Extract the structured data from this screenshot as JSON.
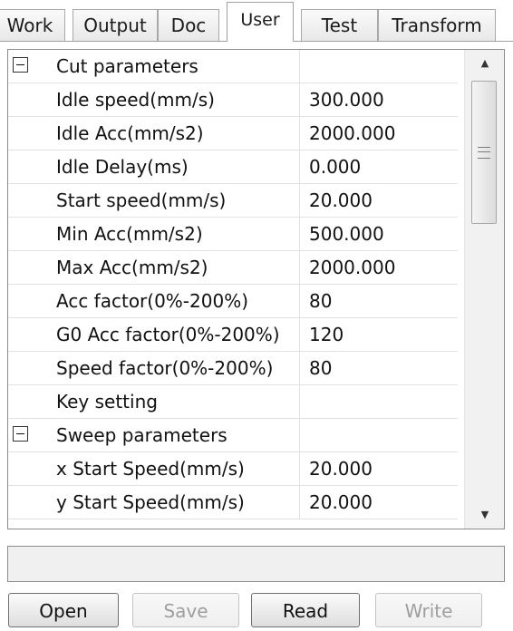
{
  "tabs": [
    {
      "label": "Work"
    },
    {
      "label": "Output"
    },
    {
      "label": "Doc"
    },
    {
      "label": "User",
      "active": true
    },
    {
      "label": "Test"
    },
    {
      "label": "Transform"
    }
  ],
  "grid": {
    "rows": [
      {
        "type": "category",
        "name": "Cut parameters",
        "value": ""
      },
      {
        "type": "property",
        "name": "Idle speed(mm/s)",
        "value": "300.000"
      },
      {
        "type": "property",
        "name": "Idle Acc(mm/s2)",
        "value": "2000.000"
      },
      {
        "type": "property",
        "name": "Idle Delay(ms)",
        "value": "0.000"
      },
      {
        "type": "property",
        "name": "Start speed(mm/s)",
        "value": "20.000"
      },
      {
        "type": "property",
        "name": "Min Acc(mm/s2)",
        "value": "500.000"
      },
      {
        "type": "property",
        "name": "Max Acc(mm/s2)",
        "value": "2000.000"
      },
      {
        "type": "property",
        "name": "Acc factor(0%-200%)",
        "value": "80"
      },
      {
        "type": "property",
        "name": "G0 Acc factor(0%-200%)",
        "value": "120"
      },
      {
        "type": "property",
        "name": "Speed factor(0%-200%)",
        "value": "80"
      },
      {
        "type": "property",
        "name": "Key setting",
        "value": ""
      },
      {
        "type": "category",
        "name": "Sweep parameters",
        "value": ""
      },
      {
        "type": "property",
        "name": "x Start Speed(mm/s)",
        "value": "20.000"
      },
      {
        "type": "property",
        "name": "y Start Speed(mm/s)",
        "value": "20.000"
      }
    ],
    "scroll_position": 0.0
  },
  "description": "",
  "buttons": {
    "open": "Open",
    "save": "Save",
    "read": "Read",
    "write": "Write"
  }
}
